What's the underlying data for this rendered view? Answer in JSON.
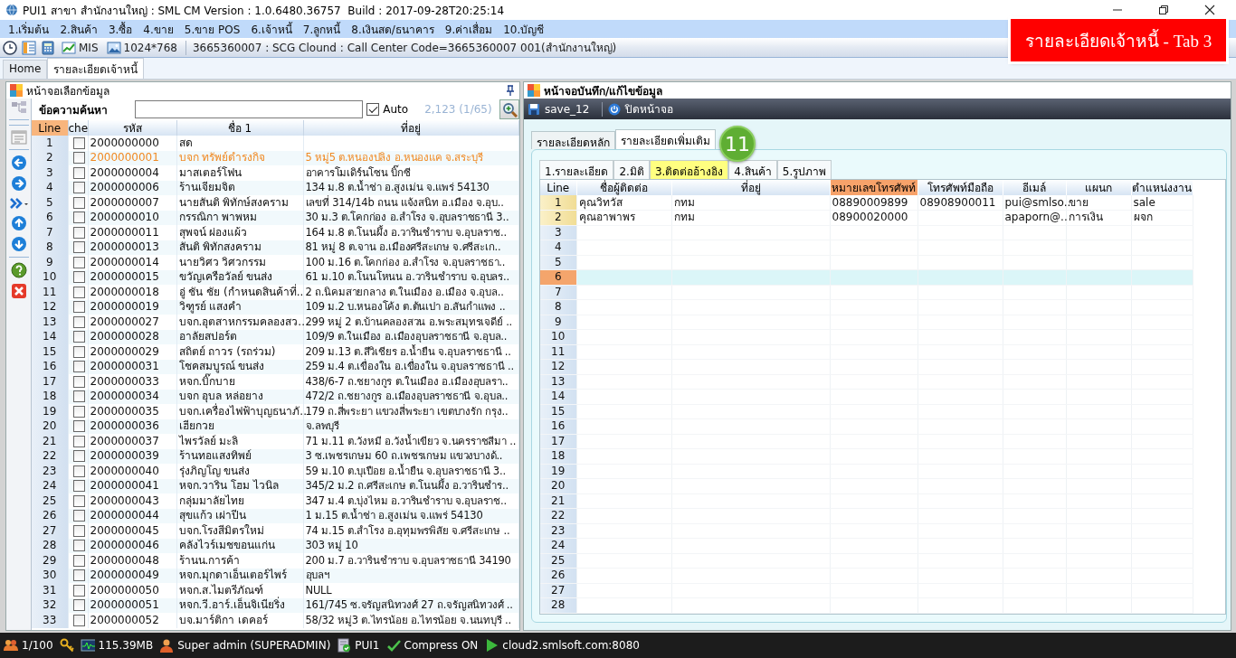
{
  "window": {
    "title": "PUI1 สาขา สำนักงานใหญ่ : SML CM Version : 1.0.6480.36757  Build : 2017-09-28T20:25:14"
  },
  "callout": {
    "text": "รายละเอียดเจ้าหนี้ - Tab 3"
  },
  "menu": [
    "1.เริ่มต้น",
    "2.สินค้า",
    "3.ซื้อ",
    "4.ขาย",
    "5.ขาย POS",
    "6.เจ้าหนี้",
    "7.ลูกหนี้",
    "8.เงินสด/ธนาคาร",
    "9.ค่าเสื่อม",
    "10.บัญชี"
  ],
  "toolbar": {
    "mis": "MIS",
    "resolution": "1024*768",
    "info": "3665360007 : SCG Clound : Call Center Code=3665360007 001(สำนักงานใหญ่)"
  },
  "doc_tabs": [
    {
      "label": "Home",
      "selected": false
    },
    {
      "label": "รายละเอียดเจ้าหนี้",
      "selected": true
    }
  ],
  "picker": {
    "title": "หน้าจอเลือกข้อมูล",
    "search_label": "ข้อความค้นหา",
    "auto": {
      "label": "Auto",
      "checked": true
    },
    "count": "2,123 (1/65)",
    "columns": [
      {
        "label": "Line",
        "selected": true
      },
      {
        "label": "che",
        "selected": false
      },
      {
        "label": "รหัส",
        "selected": false
      },
      {
        "label": "ชื่อ 1",
        "selected": false
      },
      {
        "label": "ที่อยู่",
        "selected": false
      }
    ],
    "rows": [
      {
        "line": "1",
        "checked": false,
        "code": "2000000000",
        "name": "สด",
        "selected": false
      },
      {
        "line": "2",
        "checked": false,
        "code": "2000000001",
        "name": "บจก ทรัพย์ดำรงกิจ",
        "address": "5 หมู่5 ต.หนองปลิง อ.หนองแค จ.สระบุรี",
        "selected": true
      },
      {
        "line": "3",
        "checked": false,
        "code": "2000000004",
        "name": "มาสเตอร์โฟน",
        "address": "อาคารโมเดิร์นโซน  บิ๊กซี",
        "selected": false
      },
      {
        "line": "4",
        "checked": false,
        "code": "2000000006",
        "name": "ร้านเจียมจิต",
        "address": "134 ม.8 ต.น้ำช่า อ.สูงเม่น จ.แพร่ 54130",
        "selected": false
      },
      {
        "line": "5",
        "checked": false,
        "code": "2000000007",
        "name": "นายสันติ พิทักษ์สงคราม",
        "address": "เลขที่ 314/14b ถนน แจ้งสนิท อ.เมือง จ.อุบ..",
        "selected": false
      },
      {
        "line": "6",
        "checked": false,
        "code": "2000000010",
        "name": "กรรณิกา พาพหม",
        "address": "30 ม.3 ต.โคกก่อง อ.สำโรง จ.อุบลราชธานี 3..",
        "selected": false
      },
      {
        "line": "7",
        "checked": false,
        "code": "2000000011",
        "name": "สุพจน์ ผ่องแผ้ว",
        "address": "164 ม.8  ต.โนนผึ้ง อ.วารินชำราบ จ.อุบลราช..",
        "selected": false
      },
      {
        "line": "8",
        "checked": false,
        "code": "2000000013",
        "name": "สันติ พิทักสงคราม",
        "address": "81 หมู่ 8 ต.จาน  อ.เมืองศรีสะเกษ  จ.ศรีสะเก..",
        "selected": false
      },
      {
        "line": "9",
        "checked": false,
        "code": "2000000014",
        "name": "นายวิศว วิศวกรรม",
        "address": "100 ม.16 ต.โคกก่อง อ.สำโรง จ.อุบลราชธา..",
        "selected": false
      },
      {
        "line": "10",
        "checked": false,
        "code": "2000000015",
        "name": "ขวัญเครือวัลย์ ขนส่ง",
        "address": "61 ม.10 ต.โนนโหนน อ.วารินชำราบ จ.อุบลร..",
        "selected": false
      },
      {
        "line": "11",
        "checked": false,
        "code": "2000000018",
        "name": "อู่ ชัน ชัย (กำหนดสินค้าที่..",
        "address": "2 ถ.นิคมสายกลาง ต.ในเมือง อ.เมือง จ.อุบล..",
        "selected": false
      },
      {
        "line": "12",
        "checked": false,
        "code": "2000000019",
        "name": "วิฑูรย์ แสงคำ",
        "address": "109 ม.2 บ.หนองโค้ง ต.ต้นเปา อ.สันกำแพง ..",
        "selected": false
      },
      {
        "line": "13",
        "checked": false,
        "code": "2000000027",
        "name": "บจก.อุตสาหกรรมคลองสว..",
        "address": "299 หมู่ 2 ต.บ้านคลองสวน อ.พระสมุทรเจดีย์ ..",
        "selected": false
      },
      {
        "line": "14",
        "checked": false,
        "code": "2000000028",
        "name": "อาลัยสปอร์ต",
        "address": "109/9 ต.ในเมือง อ.เมืองอุบลราชธานี จ.อุบล..",
        "selected": false
      },
      {
        "line": "15",
        "checked": false,
        "code": "2000000029",
        "name": "สถิตย์ ถาวร (รถร่วม)",
        "address": "209 ม.13 ต.สีวิเชียร อ.น้ำยืน จ.อุบลราชธานี ..",
        "selected": false
      },
      {
        "line": "16",
        "checked": false,
        "code": "2000000031",
        "name": "โชคสมบูรณ์ ขนส่ง",
        "address": "259 ม.4 ต.เขื่องใน อ.เขื่องใน จ.อุบลราชธานี ..",
        "selected": false
      },
      {
        "line": "17",
        "checked": false,
        "code": "2000000033",
        "name": "หจก.บิ๊กบาย",
        "address": "438/6-7 ถ.ชยางกูร ต.ในเมือง อ.เมืองอุบลรา..",
        "selected": false
      },
      {
        "line": "18",
        "checked": false,
        "code": "2000000034",
        "name": "บจก อุบล หล่อยาง",
        "address": "472/2 ถ.ชยางกูร อ.เมืองอุบลราชธานี จ.อุบล..",
        "selected": false
      },
      {
        "line": "19",
        "checked": false,
        "code": "2000000035",
        "name": "บจก.เครื่องไฟฟ้าบุญธนาภั..",
        "address": "179 ถ.สี่พระยา แขวงสี่พระยา เขตบางรัก กรุง..",
        "selected": false
      },
      {
        "line": "20",
        "checked": false,
        "code": "2000000036",
        "name": "เฮียกวย",
        "address": "จ.ลพบุรี",
        "selected": false
      },
      {
        "line": "21",
        "checked": false,
        "code": "2000000037",
        "name": "ไพรวัลย์ มะลิ",
        "address": "71 ม.11 ต.วังหมี อ.วังน้ำเขียว จ.นครราชสีมา ..",
        "selected": false
      },
      {
        "line": "22",
        "checked": false,
        "code": "2000000039",
        "name": "ร้านทอแสงทิพย์",
        "address": "3 ซ.เพชรเกษม 60 ถ.เพชรเกษม แขวงบางด้..",
        "selected": false
      },
      {
        "line": "23",
        "checked": false,
        "code": "2000000040",
        "name": "รุ่งภิญโญ ขนส่ง",
        "address": "59 ม.10 ต.บุเปือย อ.น้ำยืน จ.อุบลราชธานี 3..",
        "selected": false
      },
      {
        "line": "24",
        "checked": false,
        "code": "2000000041",
        "name": "หจก.วาริน โฮม ไวนิล",
        "address": "345/2 ม.2 ถ.ศรีสะเกษ ต.โนนผึ้ง อ.วารินชำร..",
        "selected": false
      },
      {
        "line": "25",
        "checked": false,
        "code": "2000000043",
        "name": "กลุ่มมาลัยไทย",
        "address": "347 ม.4 ต.บุ่งไหม อ.วารินชำราบ จ.อุบลราช..",
        "selected": false
      },
      {
        "line": "26",
        "checked": false,
        "code": "2000000044",
        "name": "สุขแก้ว เผ่าปีน",
        "address": "1 ม.15 ต.น้ำช่า อ.สูงเม่น จ.แพร่ 54130",
        "selected": false
      },
      {
        "line": "27",
        "checked": false,
        "code": "2000000045",
        "name": "บจก.โรงสีมิตรใหม่",
        "address": "74 ม.15 ต.สำโรง อ.อุทุมพรพิสัย จ.ศรีสะเกษ ..",
        "selected": false
      },
      {
        "line": "28",
        "checked": false,
        "code": "2000000046",
        "name": "คลังไวร์เมชขอนแก่น",
        "address": "303 หมู่ 10",
        "selected": false
      },
      {
        "line": "29",
        "checked": false,
        "code": "2000000048",
        "name": "ร้านน.การค้า",
        "address": "200 ม.7 อ.วารินชำราบ จ.อุบลราชธานี 34190",
        "selected": false
      },
      {
        "line": "30",
        "checked": false,
        "code": "2000000049",
        "name": "หจก.มุกดาเอ็นเตอร์ไพร์",
        "address": "อุบลฯ",
        "selected": false
      },
      {
        "line": "31",
        "checked": false,
        "code": "2000000050",
        "name": "หจก.ส.ไมตรีภัณฑ์",
        "address": "NULL",
        "selected": false
      },
      {
        "line": "32",
        "checked": false,
        "code": "2000000051",
        "name": "หจก.วี.อาร์.เอ็นจิเนียริ่ง",
        "address": "161/745 ซ.จรัญสนิทวงศ์ 27 ถ.จรัญสนิทวงศ์ ..",
        "selected": false
      },
      {
        "line": "33",
        "checked": false,
        "code": "2000000052",
        "name": "บจ.มาร์ติกา เดคอร์",
        "address": "58/32 หมู่3 ต.ไทรน้อย อ.ไทรน้อย จ.นนทบุรี ..",
        "selected": false
      }
    ]
  },
  "editor": {
    "title": "หน้าจอบันทึก/แก้ไขข้อมูล",
    "actions": [
      {
        "kind": "save",
        "label": "save_12"
      },
      {
        "kind": "power",
        "label": "ปิดหน้าจอ"
      }
    ],
    "tabs": [
      {
        "label": "รายละเอียดหลัก",
        "selected": false
      },
      {
        "label": "รายละเอียดเพิ่มเติม",
        "selected": true
      }
    ],
    "badge": "11",
    "subtabs": [
      {
        "label": "1.รายละเอียด",
        "selected": false
      },
      {
        "label": "2.มิติ",
        "selected": false
      },
      {
        "label": "3.ติดต่ออ้างอิง",
        "selected": true
      },
      {
        "label": "4.สินค้า",
        "selected": false
      },
      {
        "label": "5.รูปภาพ",
        "selected": false
      }
    ],
    "columns": [
      {
        "label": "Line",
        "selected": false
      },
      {
        "label": "ชื่อผู้ติดต่อ",
        "selected": false
      },
      {
        "label": "ที่อยู่",
        "selected": false
      },
      {
        "label": "หมายเลขโทรศัพท์",
        "selected": true
      },
      {
        "label": "โทรศัพท์มือถือ",
        "selected": false
      },
      {
        "label": "อีเมล์",
        "selected": false
      },
      {
        "label": "แผนก",
        "selected": false
      },
      {
        "label": "ตำแหน่งงาน",
        "selected": false
      }
    ],
    "rows": [
      {
        "line": "1",
        "selected": false,
        "cells": [
          "คุณวิทวัส",
          "กทม",
          "08890009899",
          "08908900011",
          "pui@smlso..",
          "ขาย",
          "sale"
        ]
      },
      {
        "line": "2",
        "selected": false,
        "cells": [
          "คุณอาพาพร",
          "กทม",
          "08900020000",
          null,
          "apaporn@..",
          "การเงิน",
          "ผจก"
        ]
      },
      {
        "line": "3",
        "selected": false
      },
      {
        "line": "4",
        "selected": false
      },
      {
        "line": "5",
        "selected": false
      },
      {
        "line": "6",
        "selected": true
      },
      {
        "line": "7",
        "selected": false
      },
      {
        "line": "8",
        "selected": false
      },
      {
        "line": "9",
        "selected": false
      },
      {
        "line": "10",
        "selected": false
      },
      {
        "line": "11",
        "selected": false
      },
      {
        "line": "12",
        "selected": false
      },
      {
        "line": "13",
        "selected": false
      },
      {
        "line": "14",
        "selected": false
      },
      {
        "line": "15",
        "selected": false
      },
      {
        "line": "16",
        "selected": false
      },
      {
        "line": "17",
        "selected": false
      },
      {
        "line": "18",
        "selected": false
      },
      {
        "line": "19",
        "selected": false
      },
      {
        "line": "20",
        "selected": false
      },
      {
        "line": "21",
        "selected": false
      },
      {
        "line": "22",
        "selected": false
      },
      {
        "line": "23",
        "selected": false
      },
      {
        "line": "24",
        "selected": false
      },
      {
        "line": "25",
        "selected": false
      },
      {
        "line": "26",
        "selected": false
      },
      {
        "line": "27",
        "selected": false
      },
      {
        "line": "28",
        "selected": false
      }
    ]
  },
  "status_bar": [
    {
      "kind": "users",
      "text": "1/100"
    },
    {
      "kind": "key"
    },
    {
      "kind": "memory",
      "text": "115.39MB"
    },
    {
      "kind": "user",
      "text": "Super admin (SUPERADMIN)"
    },
    {
      "kind": "database",
      "text": "PUI1"
    },
    {
      "kind": "check",
      "text": "Compress ON"
    },
    {
      "kind": "server",
      "text": "cloud2.smlsoft.com:8080"
    }
  ]
}
